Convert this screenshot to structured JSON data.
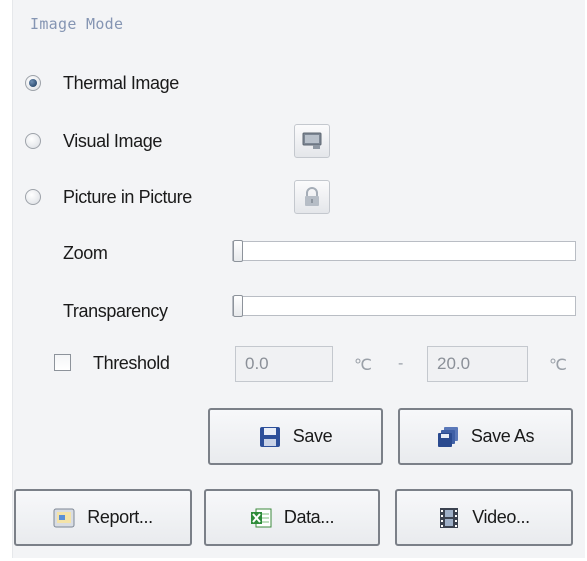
{
  "group": {
    "title": "Image Mode"
  },
  "modes": [
    {
      "label": "Thermal Image",
      "checked": true
    },
    {
      "label": "Visual Image",
      "checked": false,
      "icon": "monitor-icon"
    },
    {
      "label": "Picture in Picture",
      "checked": false,
      "icon": "lock-icon"
    }
  ],
  "zoom": {
    "label": "Zoom",
    "value": 0
  },
  "transparency": {
    "label": "Transparency",
    "value": 0
  },
  "threshold": {
    "label": "Threshold",
    "checked": false,
    "min": "0.0",
    "max": "20.0",
    "unit": "℃",
    "separator": "-"
  },
  "buttons": {
    "save": "Save",
    "save_as": "Save As",
    "report": "Report...",
    "data": "Data...",
    "video": "Video..."
  },
  "icons": {
    "save": "floppy-disk-icon",
    "save_as": "multiple-floppy-icon",
    "report": "report-icon",
    "data": "excel-icon",
    "video": "film-strip-icon"
  },
  "colors": {
    "group_title": "#8595b3",
    "panel_bg": "#f3f4f6",
    "disabled_text": "#8b9098"
  }
}
